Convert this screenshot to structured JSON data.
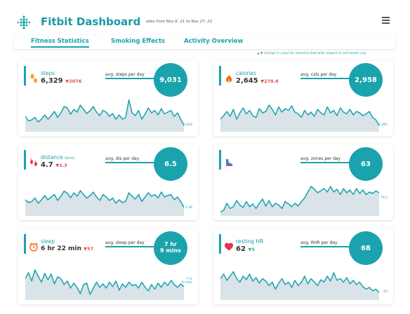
{
  "header": {
    "title": "Fitbit Dashboard",
    "subtitle": "data from Nov 8, 21 to  Nov 27, 22",
    "logo_icon": "fitbit-dots-icon",
    "menu_icon": "hamburger-menu-icon"
  },
  "tabs": [
    {
      "label": "Fitness Statistics",
      "active": true
    },
    {
      "label": "Smoking Effects",
      "active": false
    },
    {
      "label": "Activity Overview",
      "active": false
    }
  ],
  "legend": {
    "up_symbol": "▲",
    "down_symbol": "▼",
    "text": "change in value for selected date with respect to last weeks avg"
  },
  "colors": {
    "accent": "#1aa3ad",
    "down": "#e05050",
    "up": "#3cb371",
    "area": "#d9e3e8"
  },
  "cards": [
    {
      "label": "steps",
      "unit": "",
      "value": "6,329",
      "delta_symbol": "▼",
      "delta": "2076",
      "direction": "down",
      "avg_label": "avg. steps per day",
      "avg_value": "9,031",
      "avg_value_line2": "",
      "last": "3,103",
      "last_line2": "",
      "icon": "footprints-icon",
      "series": [
        0.38,
        0.25,
        0.28,
        0.35,
        0.22,
        0.3,
        0.42,
        0.3,
        0.4,
        0.52,
        0.35,
        0.48,
        0.66,
        0.62,
        0.44,
        0.58,
        0.5,
        0.7,
        0.58,
        0.46,
        0.54,
        0.66,
        0.5,
        0.4,
        0.55,
        0.5,
        0.38,
        0.46,
        0.3,
        0.42,
        0.3,
        0.35,
        0.85,
        0.48,
        0.4,
        0.55,
        0.3,
        0.45,
        0.62,
        0.48,
        0.55,
        0.42,
        0.6,
        0.45,
        0.5,
        0.55,
        0.38,
        0.48,
        0.3,
        0.12
      ]
    },
    {
      "label": "calories",
      "unit": "",
      "value": "2,645",
      "delta_symbol": "▼",
      "delta": "278.8",
      "direction": "down",
      "avg_label": "avg. cals per day",
      "avg_value": "2,958",
      "avg_value_line2": "",
      "last": "2,265",
      "last_line2": "",
      "icon": "flame-icon",
      "series": [
        0.3,
        0.4,
        0.52,
        0.38,
        0.58,
        0.3,
        0.48,
        0.62,
        0.45,
        0.55,
        0.4,
        0.35,
        0.6,
        0.48,
        0.52,
        0.7,
        0.58,
        0.42,
        0.65,
        0.5,
        0.6,
        0.55,
        0.68,
        0.5,
        0.45,
        0.35,
        0.55,
        0.42,
        0.5,
        0.38,
        0.58,
        0.48,
        0.42,
        0.65,
        0.48,
        0.55,
        0.4,
        0.62,
        0.5,
        0.45,
        0.58,
        0.42,
        0.52,
        0.48,
        0.4,
        0.45,
        0.52,
        0.35,
        0.28,
        0.12
      ]
    },
    {
      "label": "distance",
      "unit": "(kms)",
      "value": "4.7",
      "delta_symbol": "▼",
      "delta": "1.3",
      "direction": "down",
      "avg_label": "avg. dis per day",
      "avg_value": "6.5",
      "avg_value_line2": "",
      "last": "2.36",
      "last_line2": "",
      "icon": "footsteps-icon",
      "series": [
        0.4,
        0.32,
        0.35,
        0.45,
        0.3,
        0.4,
        0.52,
        0.4,
        0.48,
        0.55,
        0.38,
        0.5,
        0.65,
        0.58,
        0.46,
        0.6,
        0.5,
        0.66,
        0.55,
        0.45,
        0.52,
        0.62,
        0.48,
        0.38,
        0.55,
        0.48,
        0.38,
        0.45,
        0.3,
        0.4,
        0.32,
        0.36,
        0.6,
        0.5,
        0.42,
        0.55,
        0.35,
        0.48,
        0.6,
        0.5,
        0.55,
        0.45,
        0.62,
        0.48,
        0.52,
        0.55,
        0.4,
        0.48,
        0.35,
        0.18
      ]
    },
    {
      "label": "",
      "unit": "",
      "value": "",
      "delta_symbol": "",
      "delta": "",
      "direction": "up",
      "avg_label": "avg. zones per day",
      "avg_value": "63",
      "avg_value_line2": "",
      "last": "70.2",
      "last_line2": "",
      "icon": "running-shoe-icon",
      "series": [
        0.05,
        0.1,
        0.3,
        0.15,
        0.2,
        0.38,
        0.25,
        0.18,
        0.35,
        0.2,
        0.28,
        0.15,
        0.3,
        0.42,
        0.22,
        0.38,
        0.2,
        0.3,
        0.25,
        0.15,
        0.35,
        0.28,
        0.2,
        0.3,
        0.22,
        0.35,
        0.45,
        0.62,
        0.78,
        0.7,
        0.6,
        0.66,
        0.72,
        0.62,
        0.78,
        0.62,
        0.7,
        0.55,
        0.72,
        0.6,
        0.68,
        0.55,
        0.72,
        0.58,
        0.68,
        0.55,
        0.62,
        0.58,
        0.65,
        0.6
      ]
    },
    {
      "label": "sleep",
      "unit": "",
      "value": "6 hr 22 min",
      "delta_symbol": "▼",
      "delta": "57",
      "direction": "down",
      "avg_label": "avg. sleep per day",
      "avg_value": "7 hr",
      "avg_value_line2": "9 mins",
      "last": "7 hr",
      "last_line2": "9 mins",
      "icon": "alarm-clock-icon",
      "series": [
        0.55,
        0.72,
        0.48,
        0.8,
        0.62,
        0.45,
        0.7,
        0.52,
        0.68,
        0.4,
        0.6,
        0.55,
        0.38,
        0.48,
        0.28,
        0.42,
        0.3,
        0.12,
        0.38,
        0.42,
        0.1,
        0.28,
        0.45,
        0.3,
        0.4,
        0.28,
        0.45,
        0.32,
        0.48,
        0.22,
        0.4,
        0.3,
        0.45,
        0.35,
        0.38,
        0.28,
        0.45,
        0.3,
        0.2,
        0.38,
        0.25,
        0.42,
        0.3,
        0.45,
        0.35,
        0.5,
        0.38,
        0.3,
        0.4,
        0.32
      ]
    },
    {
      "label": "resting HR",
      "unit": "",
      "value": "62",
      "delta_symbol": "▼",
      "delta": "5",
      "direction": "up",
      "avg_label": "avg. RHR per day",
      "avg_value": "68",
      "avg_value_line2": "",
      "last": "63",
      "last_line2": "",
      "icon": "heart-icon",
      "series": [
        0.55,
        0.68,
        0.5,
        0.62,
        0.75,
        0.55,
        0.45,
        0.62,
        0.52,
        0.68,
        0.48,
        0.58,
        0.42,
        0.55,
        0.48,
        0.35,
        0.45,
        0.25,
        0.42,
        0.55,
        0.38,
        0.45,
        0.3,
        0.5,
        0.35,
        0.45,
        0.62,
        0.4,
        0.55,
        0.45,
        0.35,
        0.52,
        0.45,
        0.62,
        0.48,
        0.72,
        0.5,
        0.55,
        0.45,
        0.58,
        0.4,
        0.5,
        0.38,
        0.45,
        0.32,
        0.25,
        0.3,
        0.2,
        0.25,
        0.15
      ]
    }
  ]
}
